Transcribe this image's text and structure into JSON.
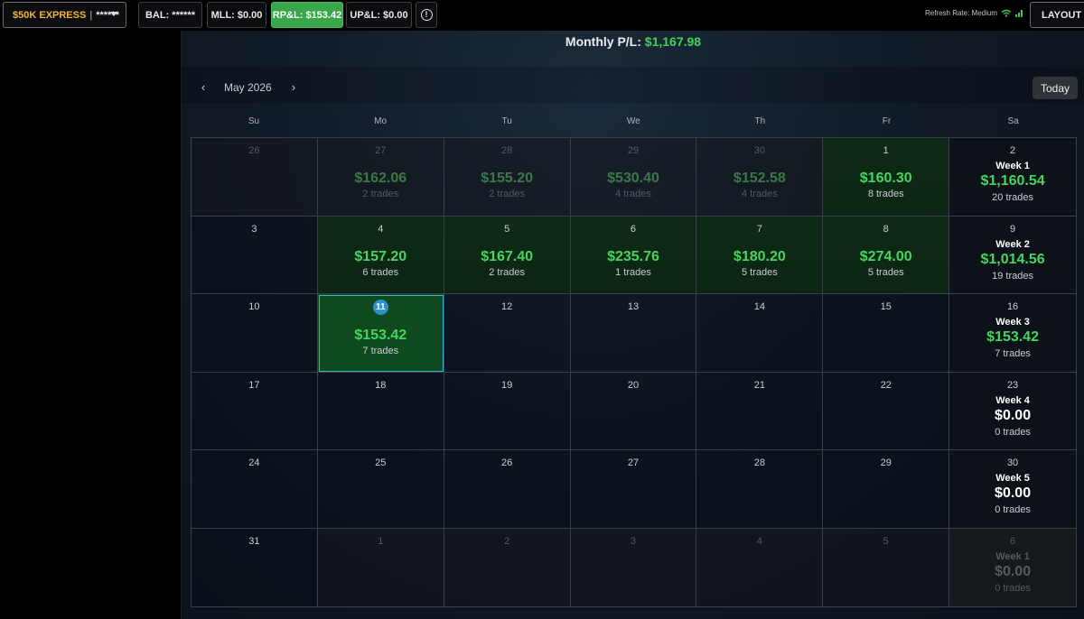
{
  "topbar": {
    "account_name": "$50K EXPRESS",
    "account_sep": "|",
    "account_masked": "******",
    "bal": "BAL: ******",
    "mll": "MLL: $0.00",
    "rpl": "RP&L: $153.42",
    "upl": "UP&L: $0.00",
    "alert_icon": "!",
    "refresh_rate": "Refresh Rate: Medium",
    "layout": "LAYOUT | NE"
  },
  "calendar": {
    "monthly_label": "Monthly P/L:",
    "monthly_value": "$1,167.98",
    "prev": "‹",
    "next": "›",
    "month": "May 2026",
    "today_button": "Today",
    "weekdays": [
      "Su",
      "Mo",
      "Tu",
      "We",
      "Th",
      "Fr",
      "Sa"
    ],
    "weeks": [
      {
        "days": [
          {
            "d": "26",
            "out": true
          },
          {
            "d": "27",
            "out": true,
            "pl": "$162.06",
            "trades": "2 trades"
          },
          {
            "d": "28",
            "out": true,
            "pl": "$155.20",
            "trades": "2 trades"
          },
          {
            "d": "29",
            "out": true,
            "pl": "$530.40",
            "trades": "4 trades"
          },
          {
            "d": "30",
            "out": true,
            "pl": "$152.58",
            "trades": "4 trades"
          },
          {
            "d": "1",
            "pl": "$160.30",
            "trades": "8 trades",
            "green": true
          }
        ],
        "sat": {
          "d": "2",
          "week": "Week 1",
          "pl": "$1,160.54",
          "trades": "20 trades"
        }
      },
      {
        "days": [
          {
            "d": "3"
          },
          {
            "d": "4",
            "pl": "$157.20",
            "trades": "6 trades",
            "green": true
          },
          {
            "d": "5",
            "pl": "$167.40",
            "trades": "2 trades",
            "green": true
          },
          {
            "d": "6",
            "pl": "$235.76",
            "trades": "1 trades",
            "green": true
          },
          {
            "d": "7",
            "pl": "$180.20",
            "trades": "5 trades",
            "green": true
          },
          {
            "d": "8",
            "pl": "$274.00",
            "trades": "5 trades",
            "green": true
          }
        ],
        "sat": {
          "d": "9",
          "week": "Week 2",
          "pl": "$1,014.56",
          "trades": "19 trades"
        }
      },
      {
        "days": [
          {
            "d": "10"
          },
          {
            "d": "11",
            "pl": "$153.42",
            "trades": "7 trades",
            "today": true
          },
          {
            "d": "12"
          },
          {
            "d": "13"
          },
          {
            "d": "14"
          },
          {
            "d": "15"
          }
        ],
        "sat": {
          "d": "16",
          "week": "Week 3",
          "pl": "$153.42",
          "trades": "7 trades"
        }
      },
      {
        "days": [
          {
            "d": "17"
          },
          {
            "d": "18"
          },
          {
            "d": "19"
          },
          {
            "d": "20"
          },
          {
            "d": "21"
          },
          {
            "d": "22"
          }
        ],
        "sat": {
          "d": "23",
          "week": "Week 4",
          "pl": "$0.00",
          "trades": "0 trades",
          "zero": true
        }
      },
      {
        "days": [
          {
            "d": "24"
          },
          {
            "d": "25"
          },
          {
            "d": "26"
          },
          {
            "d": "27"
          },
          {
            "d": "28"
          },
          {
            "d": "29"
          }
        ],
        "sat": {
          "d": "30",
          "week": "Week 5",
          "pl": "$0.00",
          "trades": "0 trades",
          "zero": true
        }
      },
      {
        "days": [
          {
            "d": "31"
          },
          {
            "d": "1",
            "out": true
          },
          {
            "d": "2",
            "out": true
          },
          {
            "d": "3",
            "out": true
          },
          {
            "d": "4",
            "out": true
          },
          {
            "d": "5",
            "out": true
          }
        ],
        "sat": {
          "d": "6",
          "week": "Week 1",
          "pl": "$0.00",
          "trades": "0 trades",
          "zero": true,
          "out": true
        }
      }
    ]
  },
  "colors": {
    "profit_green": "#47d45f",
    "rpl_button": "#3aa64b",
    "account_gold": "#f2b632",
    "today_badge": "#2c8fd2"
  }
}
